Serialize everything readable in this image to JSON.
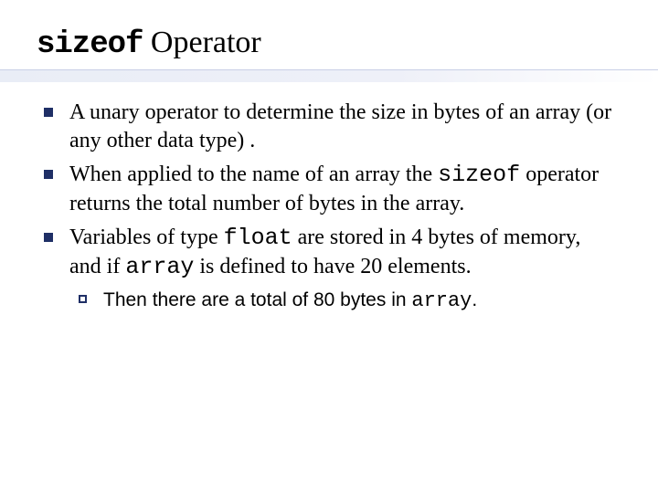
{
  "title": {
    "code": "sizeof",
    "rest": " Operator"
  },
  "bullets": [
    {
      "segments": [
        {
          "t": "A unary operator to determine the size in bytes of an array (or any other data type) ."
        }
      ]
    },
    {
      "segments": [
        {
          "t": "When applied to the name of an array the "
        },
        {
          "t": "sizeof",
          "code": true
        },
        {
          "t": " operator returns the total number of bytes in the array."
        }
      ]
    },
    {
      "segments": [
        {
          "t": "Variables of type "
        },
        {
          "t": "float",
          "code": true
        },
        {
          "t": " are stored in 4 bytes of memory, and if "
        },
        {
          "t": "array",
          "code": true
        },
        {
          "t": " is defined to have 20 elements."
        }
      ]
    }
  ],
  "subbullet": {
    "segments": [
      {
        "t": "Then there are a total of 80 bytes in "
      },
      {
        "t": "array",
        "code": true
      },
      {
        "t": "."
      }
    ]
  }
}
